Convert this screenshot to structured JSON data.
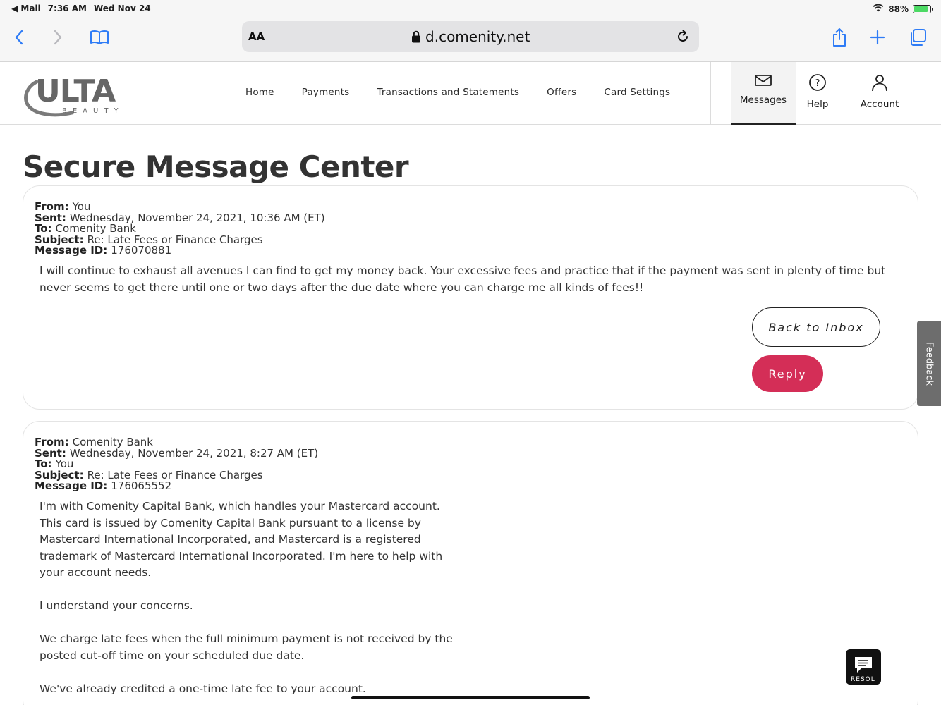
{
  "status_bar": {
    "back_app": "◀ Mail",
    "time": "7:36 AM",
    "date": "Wed Nov 24",
    "battery": "88%"
  },
  "browser": {
    "text_size_label": "AA",
    "url": "d.comenity.net"
  },
  "header": {
    "logo_text": "ULTA",
    "logo_sub": "BEAUTY",
    "nav": [
      "Home",
      "Payments",
      "Transactions and Statements",
      "Offers",
      "Card Settings"
    ],
    "utility": {
      "messages": "Messages",
      "help": "Help",
      "account": "Account"
    }
  },
  "page": {
    "title": "Secure Message Center"
  },
  "labels": {
    "from": "From:",
    "sent": "Sent:",
    "to": "To:",
    "subject": "Subject:",
    "message_id": "Message ID:"
  },
  "messages": [
    {
      "from": "You",
      "sent": "Wednesday, November 24, 2021, 10:36 AM (ET)",
      "to": "Comenity Bank",
      "subject": "Re: Late Fees or Finance Charges",
      "message_id": "176070881",
      "body": "I will continue to exhaust all avenues I can find to get my money back. Your excessive fees and practice that if the payment was sent in plenty of time but never seems to get there until one or two days after the due date where you can charge me all kinds of fees!!"
    },
    {
      "from": "Comenity Bank",
      "sent": "Wednesday, November 24, 2021, 8:27 AM (ET)",
      "to": "You",
      "subject": "Re: Late Fees or Finance Charges",
      "message_id": "176065552",
      "paragraphs": [
        "I'm with Comenity Capital Bank, which handles your Mastercard account. This card is issued by Comenity Capital Bank pursuant to a license by Mastercard International Incorporated, and Mastercard is a registered trademark of Mastercard International Incorporated. I'm here to help with your account needs.",
        "I understand your concerns.",
        "We charge late fees when the full minimum payment is not received by the posted cut-off time on your scheduled due date.",
        "We've already credited a one-time late fee to your account."
      ]
    }
  ],
  "actions": {
    "back_to_inbox": "Back to Inbox",
    "reply": "Reply"
  },
  "feedback_tab": "Feedback",
  "chat_widget_label": "RESOL",
  "colors": {
    "reply_button": "#d42e57",
    "feedback_tab": "#6d6d6d",
    "ios_blue": "#2f7cf6"
  }
}
